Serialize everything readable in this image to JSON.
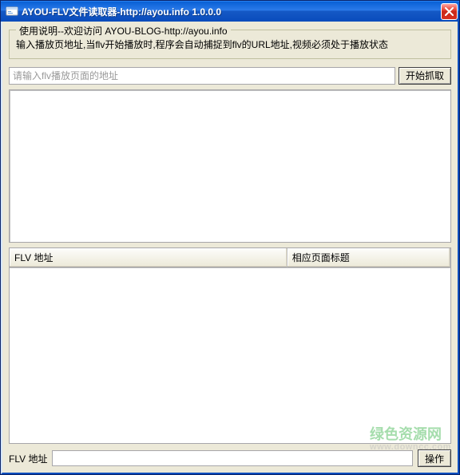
{
  "window": {
    "title": "AYOU-FLV文件读取器-http://ayou.info 1.0.0.0"
  },
  "usage_group": {
    "legend": "使用说明--欢迎访问 AYOU-BLOG-http://ayou.info",
    "text": "输入播放页地址,当flv开始播放时,程序会自动捕捉到flv的URL地址,视频必须处于播放状态"
  },
  "url_input": {
    "placeholder": "请输入flv播放页面的地址",
    "value": ""
  },
  "start_button": {
    "label": "开始抓取"
  },
  "table": {
    "columns": [
      "FLV 地址",
      "相应页面标题"
    ]
  },
  "bottom": {
    "label": "FLV 地址",
    "value": "",
    "action_button": "操作"
  },
  "watermark": {
    "main": "绿色资源网",
    "sub": "www.downcc.com"
  }
}
